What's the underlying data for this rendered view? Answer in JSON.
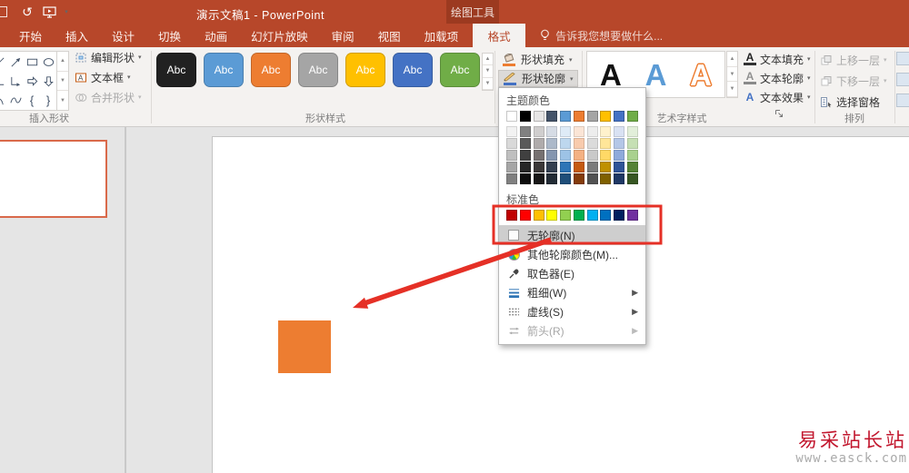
{
  "titlebar": {
    "title": "演示文稿1 - PowerPoint",
    "contextual_tab": "绘图工具"
  },
  "tabs": [
    "开始",
    "插入",
    "设计",
    "切换",
    "动画",
    "幻灯片放映",
    "审阅",
    "视图",
    "加载项"
  ],
  "active_tab": "格式",
  "search_placeholder": "告诉我您想要做什么...",
  "ribbon": {
    "insert_shapes": {
      "label": "插入形状",
      "buttons": [
        {
          "label": "编辑形状",
          "disabled": false
        },
        {
          "label": "文本框",
          "disabled": false
        },
        {
          "label": "合并形状",
          "disabled": true
        }
      ]
    },
    "shape_styles": {
      "label": "形状样式",
      "preview_text": "Abc",
      "chips": [
        "#212121",
        "#5B9BD5",
        "#ED7D31",
        "#A5A5A5",
        "#FFC000",
        "#4472C4",
        "#70AD47"
      ]
    },
    "shape_fill_label": "形状填充",
    "shape_outline_label": "形状轮廓",
    "wordart": {
      "label": "艺术字样式",
      "letters": [
        "A",
        "A",
        "A"
      ],
      "buttons": [
        "文本填充",
        "文本轮廓",
        "文本效果"
      ]
    },
    "arrange": {
      "label": "排列",
      "items": [
        {
          "label": "上移一层",
          "disabled": true
        },
        {
          "label": "下移一层",
          "disabled": true
        },
        {
          "label": "选择窗格",
          "disabled": false
        }
      ]
    }
  },
  "dropdown": {
    "theme_label": "主题颜色",
    "standard_label": "标准色",
    "theme_colors": [
      "#FFFFFF",
      "#000000",
      "#E7E6E6",
      "#44546A",
      "#5B9BD5",
      "#ED7D31",
      "#A5A5A5",
      "#FFC000",
      "#4472C4",
      "#70AD47"
    ],
    "theme_variants": [
      [
        "#F2F2F2",
        "#D9D9D9",
        "#BFBFBF",
        "#A6A6A6",
        "#808080"
      ],
      [
        "#808080",
        "#595959",
        "#404040",
        "#262626",
        "#0D0D0D"
      ],
      [
        "#D0CECE",
        "#AFABAB",
        "#767171",
        "#3B3838",
        "#181717"
      ],
      [
        "#D6DCE5",
        "#ACB9CA",
        "#8496B0",
        "#333F50",
        "#222B35"
      ],
      [
        "#DEEBF7",
        "#BDD7EE",
        "#9DC3E6",
        "#2E75B6",
        "#1F4E79"
      ],
      [
        "#FBE5D6",
        "#F8CBAD",
        "#F4B183",
        "#C55A11",
        "#843C0C"
      ],
      [
        "#EDEDED",
        "#DBDBDB",
        "#C9C9C9",
        "#7B7B7B",
        "#525252"
      ],
      [
        "#FFF2CC",
        "#FFE699",
        "#FFD966",
        "#BF9000",
        "#7F6000"
      ],
      [
        "#D9E2F3",
        "#B4C7E7",
        "#8EAADB",
        "#2F5497",
        "#1F3864"
      ],
      [
        "#E2EFDA",
        "#C6E0B4",
        "#A9D18E",
        "#548235",
        "#375623"
      ]
    ],
    "standard_colors": [
      "#C00000",
      "#FF0000",
      "#FFC000",
      "#FFFF00",
      "#92D050",
      "#00B050",
      "#00B0F0",
      "#0070C0",
      "#002060",
      "#7030A0"
    ],
    "no_outline_label": "无轮廓(N)",
    "items": [
      {
        "label": "其他轮廓颜色(M)...",
        "icon": "color-wheel-icon",
        "submenu": false,
        "disabled": false
      },
      {
        "label": "取色器(E)",
        "icon": "eyedropper-icon",
        "submenu": false,
        "disabled": false
      },
      {
        "label": "粗细(W)",
        "icon": "line-weight-icon",
        "submenu": true,
        "disabled": false
      },
      {
        "label": "虚线(S)",
        "icon": "dash-style-icon",
        "submenu": true,
        "disabled": false
      },
      {
        "label": "箭头(R)",
        "icon": "arrows-icon",
        "submenu": true,
        "disabled": true
      }
    ]
  },
  "slide": {
    "shape_color": "#ED7D31"
  },
  "watermark": {
    "line1": "易采站长站",
    "line2": "www.easck.com"
  },
  "icons": {
    "undo": "↺",
    "dropdown_caret": "▾",
    "submenu_caret": "▶",
    "scroll_up": "▲",
    "scroll_down": "▼",
    "left_brace": "{",
    "right_brace": "}"
  },
  "colors": {
    "titlebar_bg": "#B7472A",
    "contextual_tab_bg": "#9C3A20",
    "ribbon_bg": "#F4F2F0",
    "canvas_bg": "#E5E5E5",
    "annotation": "#E53026",
    "selection_border": "#D9694A",
    "menu_highlight": "#CECECE"
  }
}
